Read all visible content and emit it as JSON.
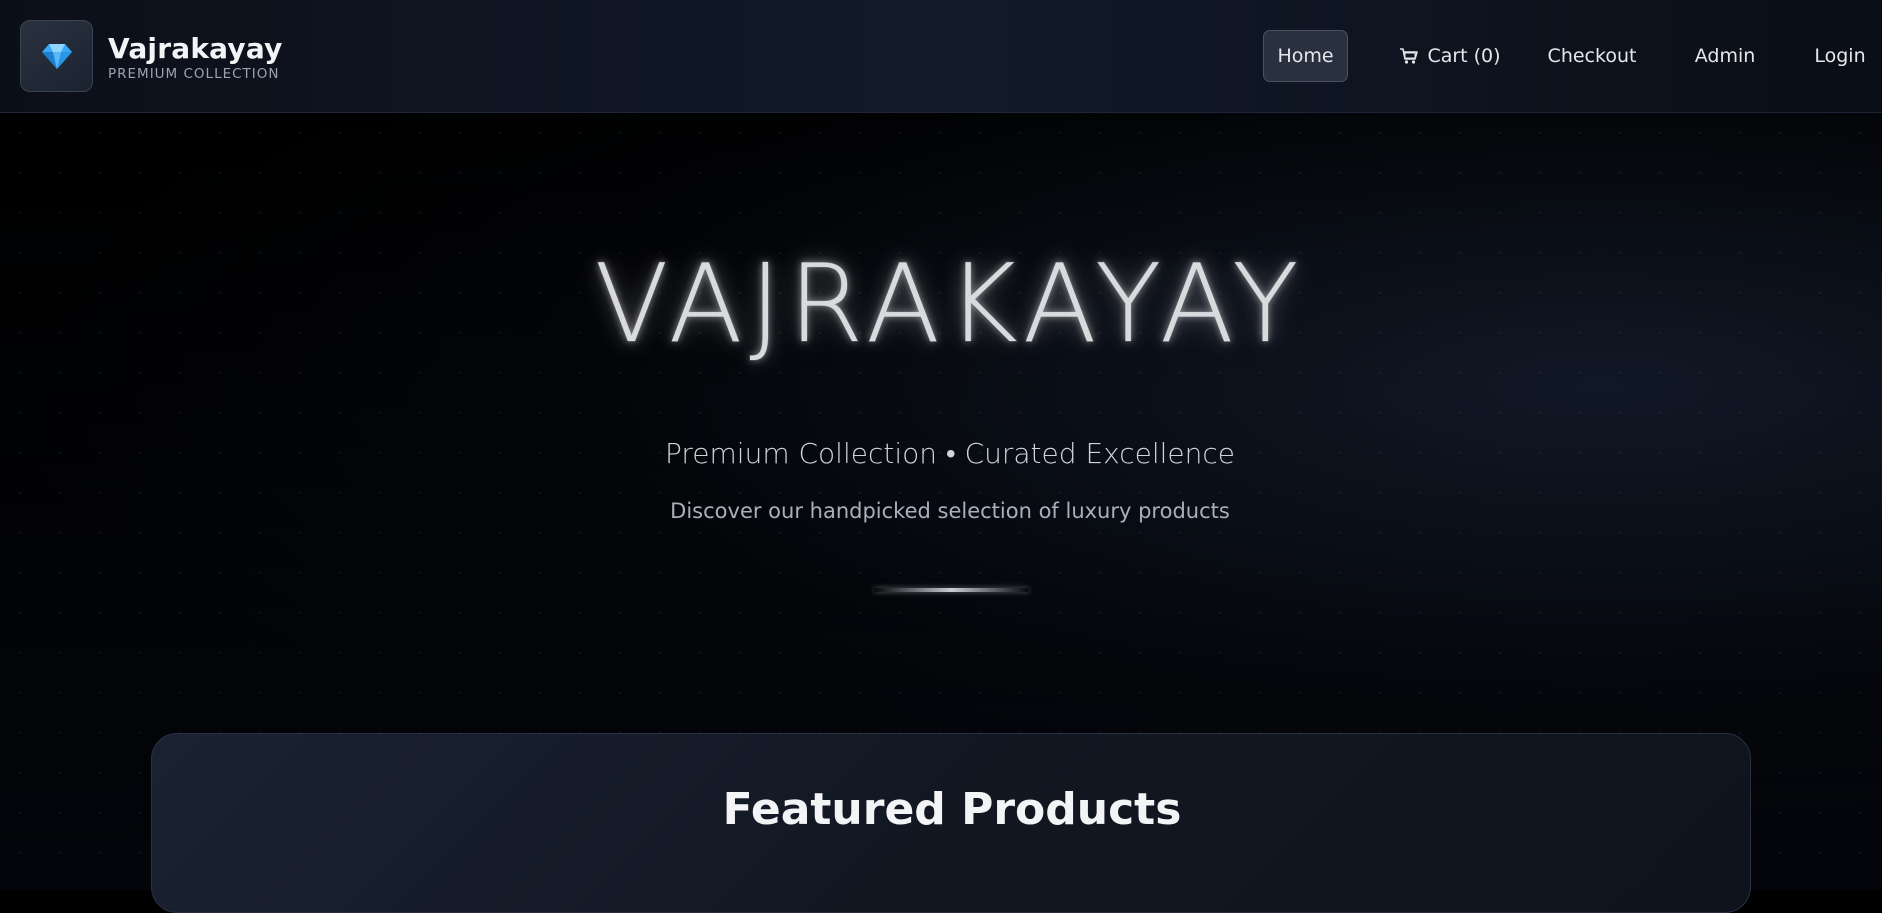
{
  "brand": {
    "name": "Vajrakayay",
    "subtitle": "PREMIUM COLLECTION",
    "logo_icon": "diamond-icon"
  },
  "nav": {
    "home": "Home",
    "cart": "Cart (0)",
    "cart_icon": "cart-icon",
    "checkout": "Checkout",
    "admin": "Admin",
    "login": "Login",
    "active": "Home"
  },
  "hero": {
    "title": "VAJRAKAYAY",
    "tagline": "Premium Collection • Curated Excellence",
    "description": "Discover our handpicked selection of luxury products"
  },
  "featured": {
    "title": "Featured Products"
  },
  "colors": {
    "background": "#000000",
    "header": "#121a2a",
    "accent_diamond": "#3aa9f5",
    "active_nav": "#293140"
  }
}
